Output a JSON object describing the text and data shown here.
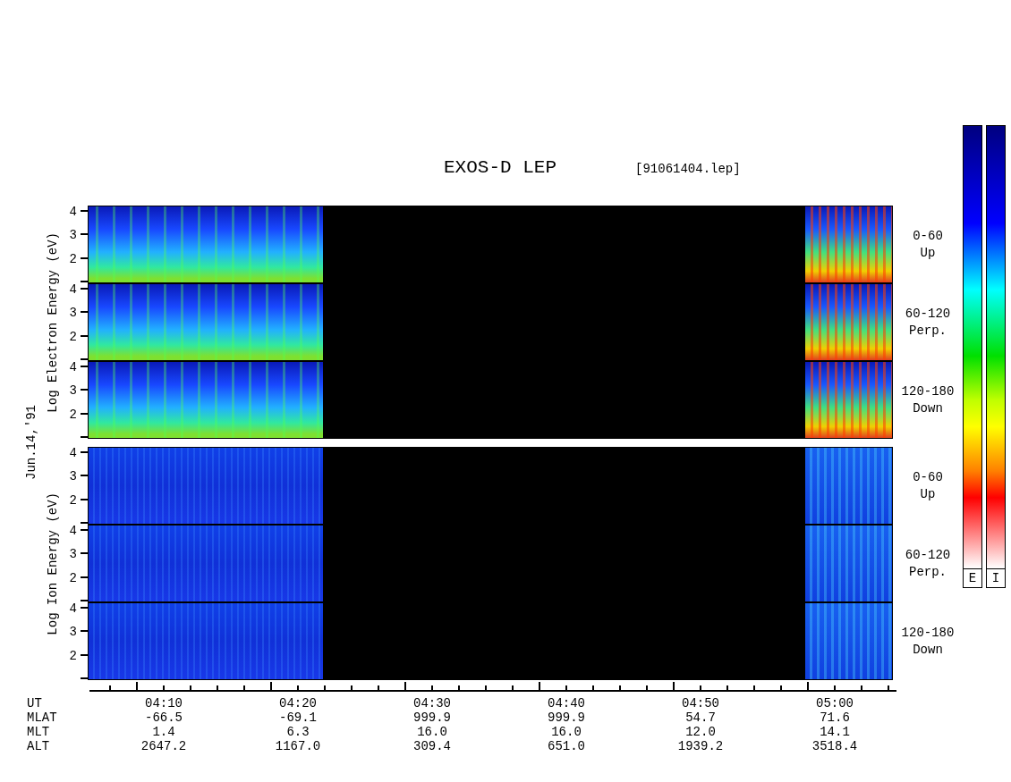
{
  "title": "EXOS-D LEP",
  "file_name": "[91061404.lep]",
  "date_label": "Jun.14,'91",
  "groups": [
    {
      "kind": "electron",
      "axis_label": "Log Electron Energy (eV)",
      "panels": [
        {
          "ticks": [
            "4",
            "3",
            "2"
          ],
          "range": "0-60",
          "direction": "Up"
        },
        {
          "ticks": [
            "4",
            "3",
            "2"
          ],
          "range": "60-120",
          "direction": "Perp."
        },
        {
          "ticks": [
            "4",
            "3",
            "2"
          ],
          "range": "120-180",
          "direction": "Down"
        }
      ]
    },
    {
      "kind": "ion",
      "axis_label": "Log Ion Energy (eV)",
      "panels": [
        {
          "ticks": [
            "4",
            "3",
            "2"
          ],
          "range": "0-60",
          "direction": "Up"
        },
        {
          "ticks": [
            "4",
            "3",
            "2"
          ],
          "range": "60-120",
          "direction": "Perp."
        },
        {
          "ticks": [
            "4",
            "3",
            "2"
          ],
          "range": "120-180",
          "direction": "Down"
        }
      ]
    }
  ],
  "ephemeris": [
    {
      "label": "UT",
      "values": [
        "04:10",
        "04:20",
        "04:30",
        "04:40",
        "04:50",
        "05:00"
      ]
    },
    {
      "label": "MLAT",
      "values": [
        "-66.5",
        "-69.1",
        "999.9",
        "999.9",
        "54.7",
        "71.6"
      ]
    },
    {
      "label": "MLT",
      "values": [
        "1.4",
        "6.3",
        "16.0",
        "16.0",
        "12.0",
        "14.1"
      ]
    },
    {
      "label": "ALT",
      "values": [
        "2647.2",
        "1167.0",
        "309.4",
        "651.0",
        "1939.2",
        "3518.4"
      ]
    }
  ],
  "color_scales": [
    {
      "label": "E"
    },
    {
      "label": "I"
    }
  ]
}
